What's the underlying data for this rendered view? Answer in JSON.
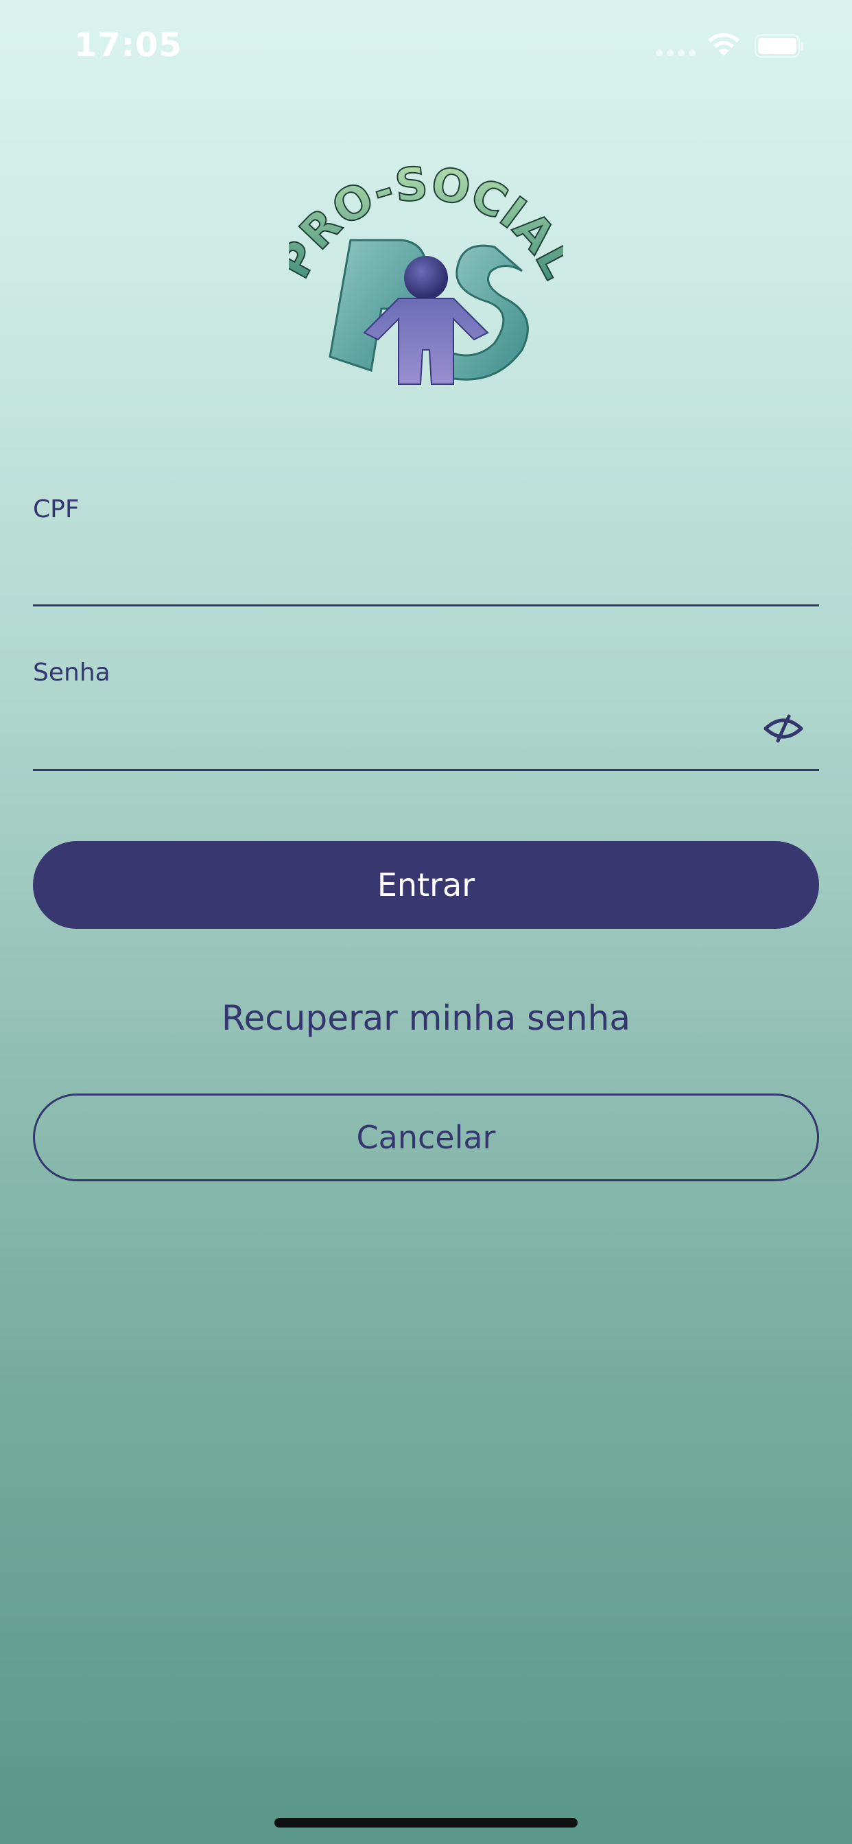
{
  "status_bar": {
    "time": "17:05",
    "icons": [
      "cellular-signal-icon",
      "wifi-icon",
      "battery-icon"
    ]
  },
  "logo": {
    "text": "PRO-SOCIAL",
    "icon": "pro-social-pis-logo"
  },
  "form": {
    "cpf": {
      "label": "CPF",
      "value": "",
      "placeholder": ""
    },
    "senha": {
      "label": "Senha",
      "value": "",
      "placeholder": "",
      "toggle_icon": "eye-slash-icon"
    }
  },
  "actions": {
    "login_label": "Entrar",
    "recover_label": "Recuperar minha senha",
    "cancel_label": "Cancelar"
  },
  "colors": {
    "primary": "#383770",
    "text": "#33376e",
    "background_top": "#daf3ee",
    "background_bottom": "#5a9789"
  }
}
